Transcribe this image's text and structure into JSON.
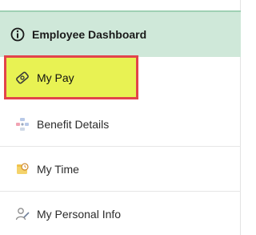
{
  "header": {
    "title": "Employee Dashboard",
    "icon": "info-circle-icon"
  },
  "menu": {
    "items": [
      {
        "label": "My Pay",
        "icon": "tag-money-icon",
        "selected": true
      },
      {
        "label": "Benefit Details",
        "icon": "benefits-icon",
        "selected": false
      },
      {
        "label": "My Time",
        "icon": "clock-folder-icon",
        "selected": false
      },
      {
        "label": "My Personal Info",
        "icon": "user-edit-icon",
        "selected": false
      }
    ]
  },
  "colors": {
    "header_bg": "#cfe8d9",
    "selected_bg": "#e8f253",
    "selected_border": "#e2444b"
  }
}
